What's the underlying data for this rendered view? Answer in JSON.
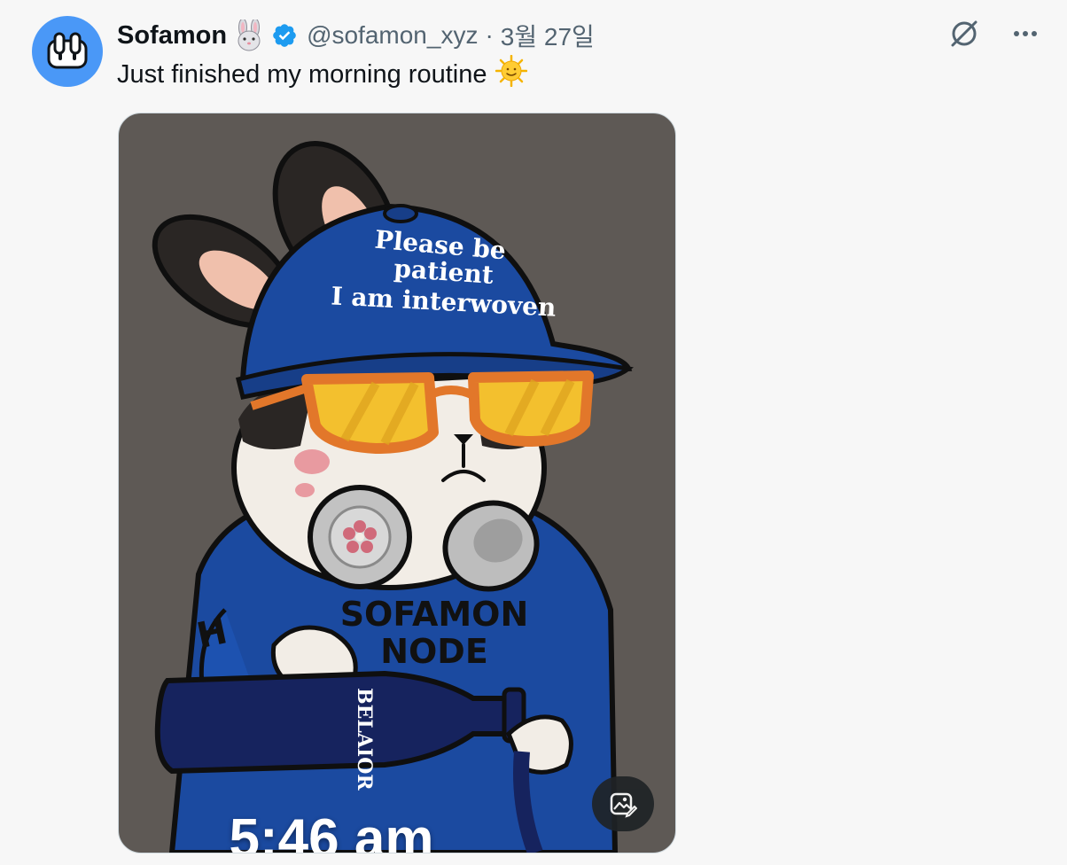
{
  "tweet": {
    "author": {
      "display_name": "Sofamon",
      "name_emoji": "rabbit-emoji",
      "verified_icon": "verified-badge-icon",
      "handle": "@sofamon_xyz"
    },
    "separator": "·",
    "date": "3월 27일",
    "text": "Just finished my morning routine",
    "text_emoji": "sun-with-face-emoji",
    "actions": {
      "grok_icon": "grok-icon",
      "more_icon": "more-icon"
    },
    "media": {
      "image_name": "sofamon-bunny-illustration",
      "cap_text": [
        "Please be",
        "patient",
        "I am interwoven"
      ],
      "hoodie_text": [
        "SOFAMON",
        "NODE"
      ],
      "sleeve_letter": "H",
      "bottle_text": "BELAIOR",
      "caption": "5:46 am",
      "edit_icon": "image-edit-icon"
    },
    "colors": {
      "accent": "#1d9bf0",
      "avatar_bg": "#4a98f7",
      "muted_text": "#536471",
      "media_bg": "#5e5955",
      "cap_blue": "#1b4aa0"
    }
  }
}
